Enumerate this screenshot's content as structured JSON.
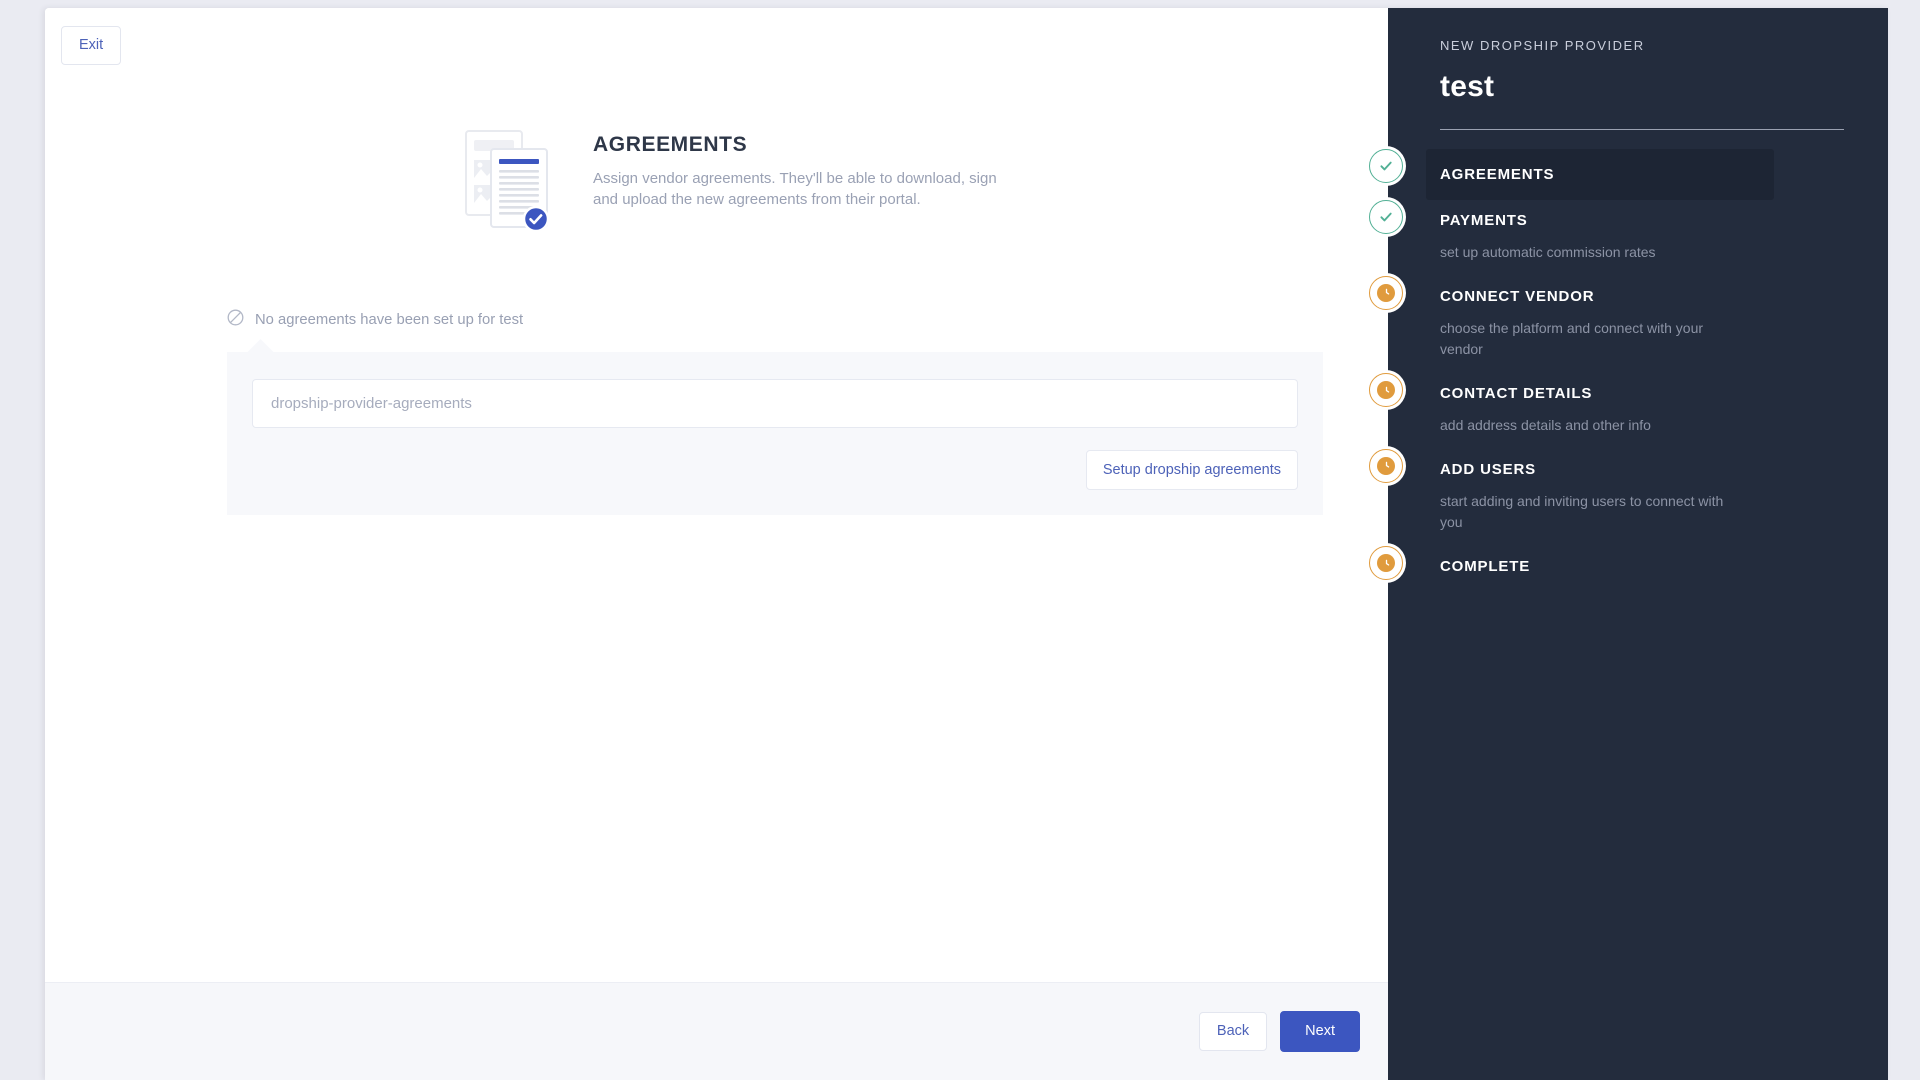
{
  "colors": {
    "page_bg": "#eaebf2",
    "sidebar_bg": "#232c3d",
    "sidebar_active_bg": "#1d2534",
    "primary_blue": "#3c56c0",
    "link_blue": "#4d62b8",
    "done_green": "#52b095",
    "pending_orange": "#e09b3d",
    "panel_bg": "#f7f8fb",
    "footer_bg": "#f6f7fa",
    "muted_text": "#9aa1b4"
  },
  "topbar": {
    "exit_label": "Exit"
  },
  "hero": {
    "title": "AGREEMENTS",
    "description": "Assign vendor agreements. They'll be able to download, sign and upload the new agreements from their portal.",
    "illustration": "documents-check-illustration"
  },
  "empty_state": {
    "icon": "no-entry-icon",
    "message": "No agreements have been set up for test"
  },
  "form": {
    "input_value": "",
    "input_placeholder": "dropship-provider-agreements",
    "setup_button_label": "Setup dropship agreements"
  },
  "footer": {
    "back_label": "Back",
    "next_label": "Next"
  },
  "sidebar": {
    "kicker": "NEW DROPSHIP PROVIDER",
    "title": "test",
    "steps": [
      {
        "label": "AGREEMENTS",
        "sub": "",
        "status": "done",
        "active": true,
        "icon": "check-icon"
      },
      {
        "label": "PAYMENTS",
        "sub": "set up automatic commission rates",
        "status": "done",
        "active": false,
        "icon": "check-icon"
      },
      {
        "label": "CONNECT VENDOR",
        "sub": "choose the platform and connect with your vendor",
        "status": "pending",
        "active": false,
        "icon": "clock-icon"
      },
      {
        "label": "CONTACT DETAILS",
        "sub": "add address details and other info",
        "status": "pending",
        "active": false,
        "icon": "clock-icon"
      },
      {
        "label": "ADD USERS",
        "sub": "start adding and inviting users to connect with you",
        "status": "pending",
        "active": false,
        "icon": "clock-icon"
      },
      {
        "label": "COMPLETE",
        "sub": "",
        "status": "pending",
        "active": false,
        "icon": "clock-icon"
      }
    ]
  }
}
